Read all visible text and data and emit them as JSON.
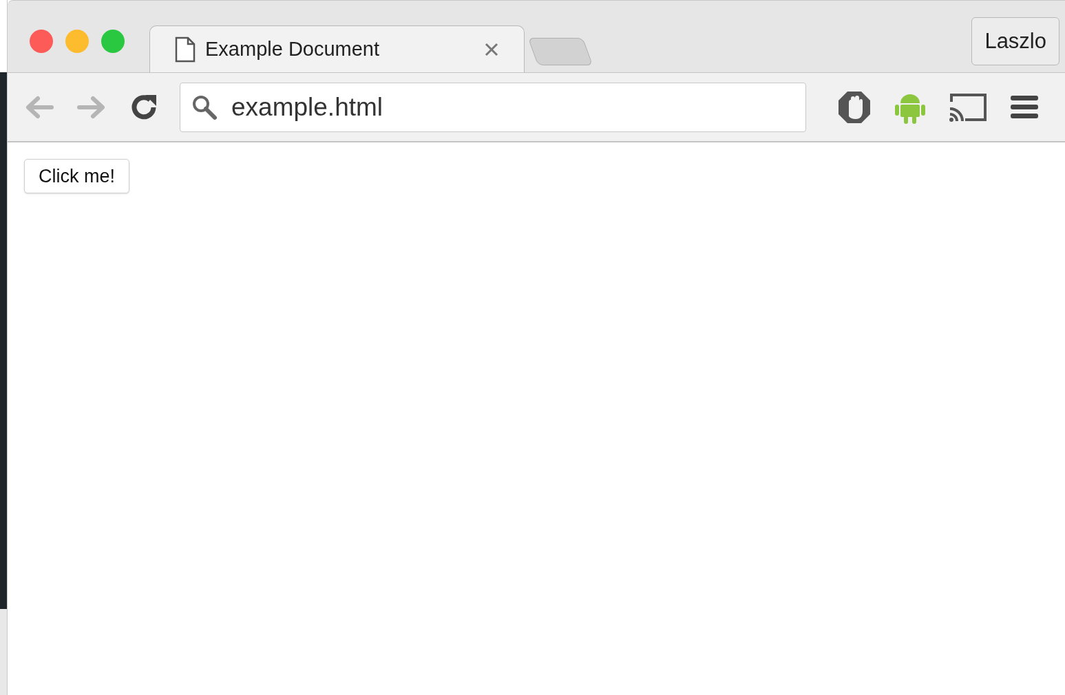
{
  "tabs": [
    {
      "title": "Example Document",
      "selected": true
    }
  ],
  "profile": {
    "name": "Laszlo"
  },
  "navigation": {
    "back_disabled": true,
    "forward_disabled": true
  },
  "address_bar": {
    "value": "example.html"
  },
  "page": {
    "button": "Click me!"
  }
}
